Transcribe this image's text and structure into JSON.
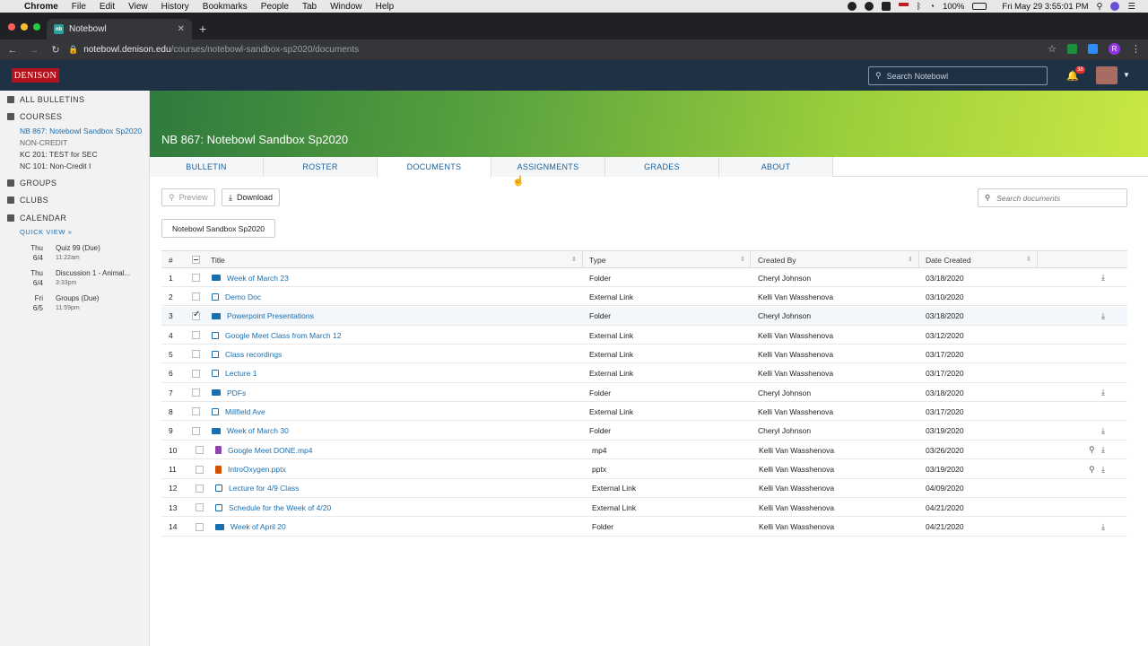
{
  "macbar": {
    "apple": "",
    "app": "Chrome",
    "menus": [
      "File",
      "Edit",
      "View",
      "History",
      "Bookmarks",
      "People",
      "Tab",
      "Window",
      "Help"
    ],
    "battery": "100%",
    "datetime": "Fri May 29  3:55:01 PM"
  },
  "browser": {
    "tab_title": "Notebowl",
    "favicon_text": "nb",
    "url_host": "notebowl.denison.edu",
    "url_path": "/courses/notebowl-sandbox-sp2020/documents",
    "profile_initial": "R"
  },
  "header": {
    "logo": "DENISON",
    "search_placeholder": "Search Notebowl",
    "notification_count": "38"
  },
  "sidebar": {
    "all_bulletins": "ALL BULLETINS",
    "courses": "COURSES",
    "course_items": [
      {
        "label": "NB 867: Notebowl Sandbox Sp2020"
      },
      {
        "label": "NON-CREDIT"
      },
      {
        "label": "KC 201: TEST for SEC"
      },
      {
        "label": "NC 101: Non-Credit I"
      }
    ],
    "groups": "GROUPS",
    "clubs": "CLUBS",
    "calendar": "CALENDAR",
    "quick_view": "QUICK VIEW",
    "events": [
      {
        "day": "Thu",
        "date": "6/4",
        "title": "Quiz 99 (Due)",
        "time": "11:22am"
      },
      {
        "day": "Thu",
        "date": "6/4",
        "title": "Discussion 1 - Animal...",
        "time": "3:33pm"
      },
      {
        "day": "Fri",
        "date": "6/5",
        "title": "Groups (Due)",
        "time": "11:59pm"
      }
    ]
  },
  "course": {
    "title": "NB 867: Notebowl Sandbox Sp2020",
    "tabs": [
      "BULLETIN",
      "ROSTER",
      "DOCUMENTS",
      "ASSIGNMENTS",
      "GRADES",
      "ABOUT"
    ]
  },
  "toolbar": {
    "preview": "Preview",
    "download": "Download",
    "search_placeholder": "Search documents",
    "breadcrumb": "Notebowl Sandbox Sp2020"
  },
  "table": {
    "headers": {
      "num": "#",
      "title": "Title",
      "type": "Type",
      "created_by": "Created By",
      "date_created": "Date Created"
    },
    "rows": [
      {
        "num": "1",
        "title": "Week of March 23",
        "type": "Folder",
        "created_by": "Cheryl Johnson",
        "date": "03/18/2020",
        "icon": "folder-icon",
        "checked": false,
        "download": true,
        "preview": false
      },
      {
        "num": "2",
        "title": "Demo Doc",
        "type": "External Link",
        "created_by": "Kelli Van Wasshenova",
        "date": "03/10/2020",
        "icon": "external-link-icon",
        "checked": false,
        "download": false,
        "preview": false
      },
      {
        "num": "3",
        "title": "Powerpoint Presentations",
        "type": "Folder",
        "created_by": "Cheryl Johnson",
        "date": "03/18/2020",
        "icon": "folder-icon",
        "checked": true,
        "download": true,
        "preview": false
      },
      {
        "num": "4",
        "title": "Google Meet Class from March 12",
        "type": "External Link",
        "created_by": "Kelli Van Wasshenova",
        "date": "03/12/2020",
        "icon": "external-link-icon",
        "checked": false,
        "download": false,
        "preview": false
      },
      {
        "num": "5",
        "title": "Class recordings",
        "type": "External Link",
        "created_by": "Kelli Van Wasshenova",
        "date": "03/17/2020",
        "icon": "external-link-icon",
        "checked": false,
        "download": false,
        "preview": false
      },
      {
        "num": "6",
        "title": "Lecture 1",
        "type": "External Link",
        "created_by": "Kelli Van Wasshenova",
        "date": "03/17/2020",
        "icon": "external-link-icon",
        "checked": false,
        "download": false,
        "preview": false
      },
      {
        "num": "7",
        "title": "PDFs",
        "type": "Folder",
        "created_by": "Cheryl Johnson",
        "date": "03/18/2020",
        "icon": "folder-icon",
        "checked": false,
        "download": true,
        "preview": false
      },
      {
        "num": "8",
        "title": "Millfield Ave",
        "type": "External Link",
        "created_by": "Kelli Van Wasshenova",
        "date": "03/17/2020",
        "icon": "external-link-icon",
        "checked": false,
        "download": false,
        "preview": false
      },
      {
        "num": "9",
        "title": "Week of March 30",
        "type": "Folder",
        "created_by": "Cheryl Johnson",
        "date": "03/19/2020",
        "icon": "folder-icon",
        "checked": false,
        "download": true,
        "preview": false
      },
      {
        "num": "10",
        "title": "Google Meet DONE.mp4",
        "type": "mp4",
        "created_by": "Kelli Van Wasshenova",
        "date": "03/26/2020",
        "icon": "video-file-icon",
        "checked": false,
        "download": true,
        "preview": true
      },
      {
        "num": "11",
        "title": "IntroOxygen.pptx",
        "type": "pptx",
        "created_by": "Kelli Van Wasshenova",
        "date": "03/19/2020",
        "icon": "powerpoint-file-icon",
        "checked": false,
        "download": true,
        "preview": true
      },
      {
        "num": "12",
        "title": "Lecture for 4/9 Class",
        "type": "External Link",
        "created_by": "Kelli Van Wasshenova",
        "date": "04/09/2020",
        "icon": "external-link-icon",
        "checked": false,
        "download": false,
        "preview": false
      },
      {
        "num": "13",
        "title": "Schedule for the Week of 4/20",
        "type": "External Link",
        "created_by": "Kelli Van Wasshenova",
        "date": "04/21/2020",
        "icon": "external-link-icon",
        "checked": false,
        "download": false,
        "preview": false
      },
      {
        "num": "14",
        "title": "Week of April 20",
        "type": "Folder",
        "created_by": "Kelli Van Wasshenova",
        "date": "04/21/2020",
        "icon": "folder-icon",
        "checked": false,
        "download": true,
        "preview": false
      }
    ]
  },
  "colors": {
    "link": "#1a6fb0",
    "header_bg": "#1f3145",
    "logo_red": "#b5121b"
  }
}
